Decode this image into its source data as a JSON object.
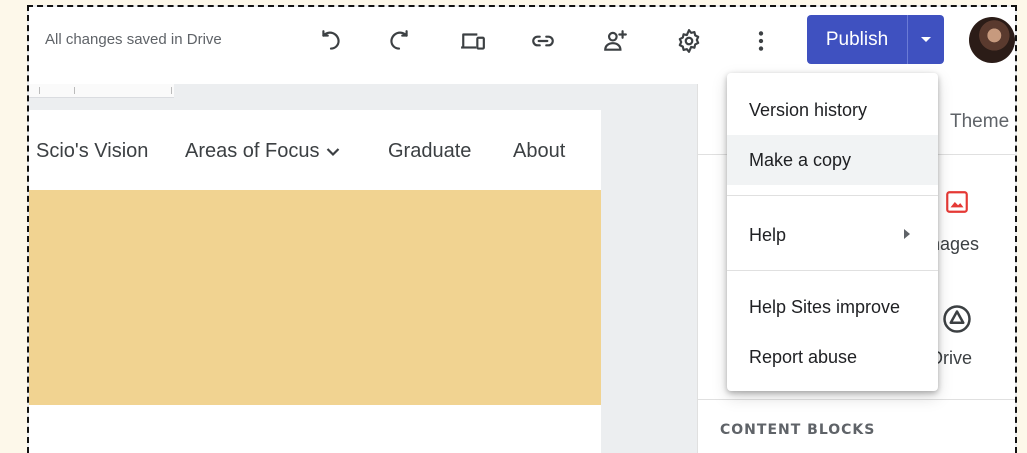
{
  "topbar": {
    "status": "All changes saved in Drive",
    "icons": [
      "undo-icon",
      "redo-icon",
      "preview-icon",
      "link-icon",
      "share-icon",
      "settings-icon",
      "more-vert-icon"
    ],
    "publish_label": "Publish"
  },
  "page": {
    "nav": [
      "Scio's Vision",
      "Areas of Focus",
      "Graduate",
      "About"
    ],
    "banner_color": "#f1d391"
  },
  "panel": {
    "tab_partial": "Theme",
    "images_label": "nages",
    "drive_label": "Drive",
    "content_blocks_label": "CONTENT BLOCKS"
  },
  "menu": {
    "items": [
      "Version history",
      "Make a copy",
      "Help",
      "Help Sites improve",
      "Report abuse"
    ]
  },
  "colors": {
    "accent": "#3f51c0",
    "banner": "#f1d391",
    "images_icon": "#e53935"
  }
}
